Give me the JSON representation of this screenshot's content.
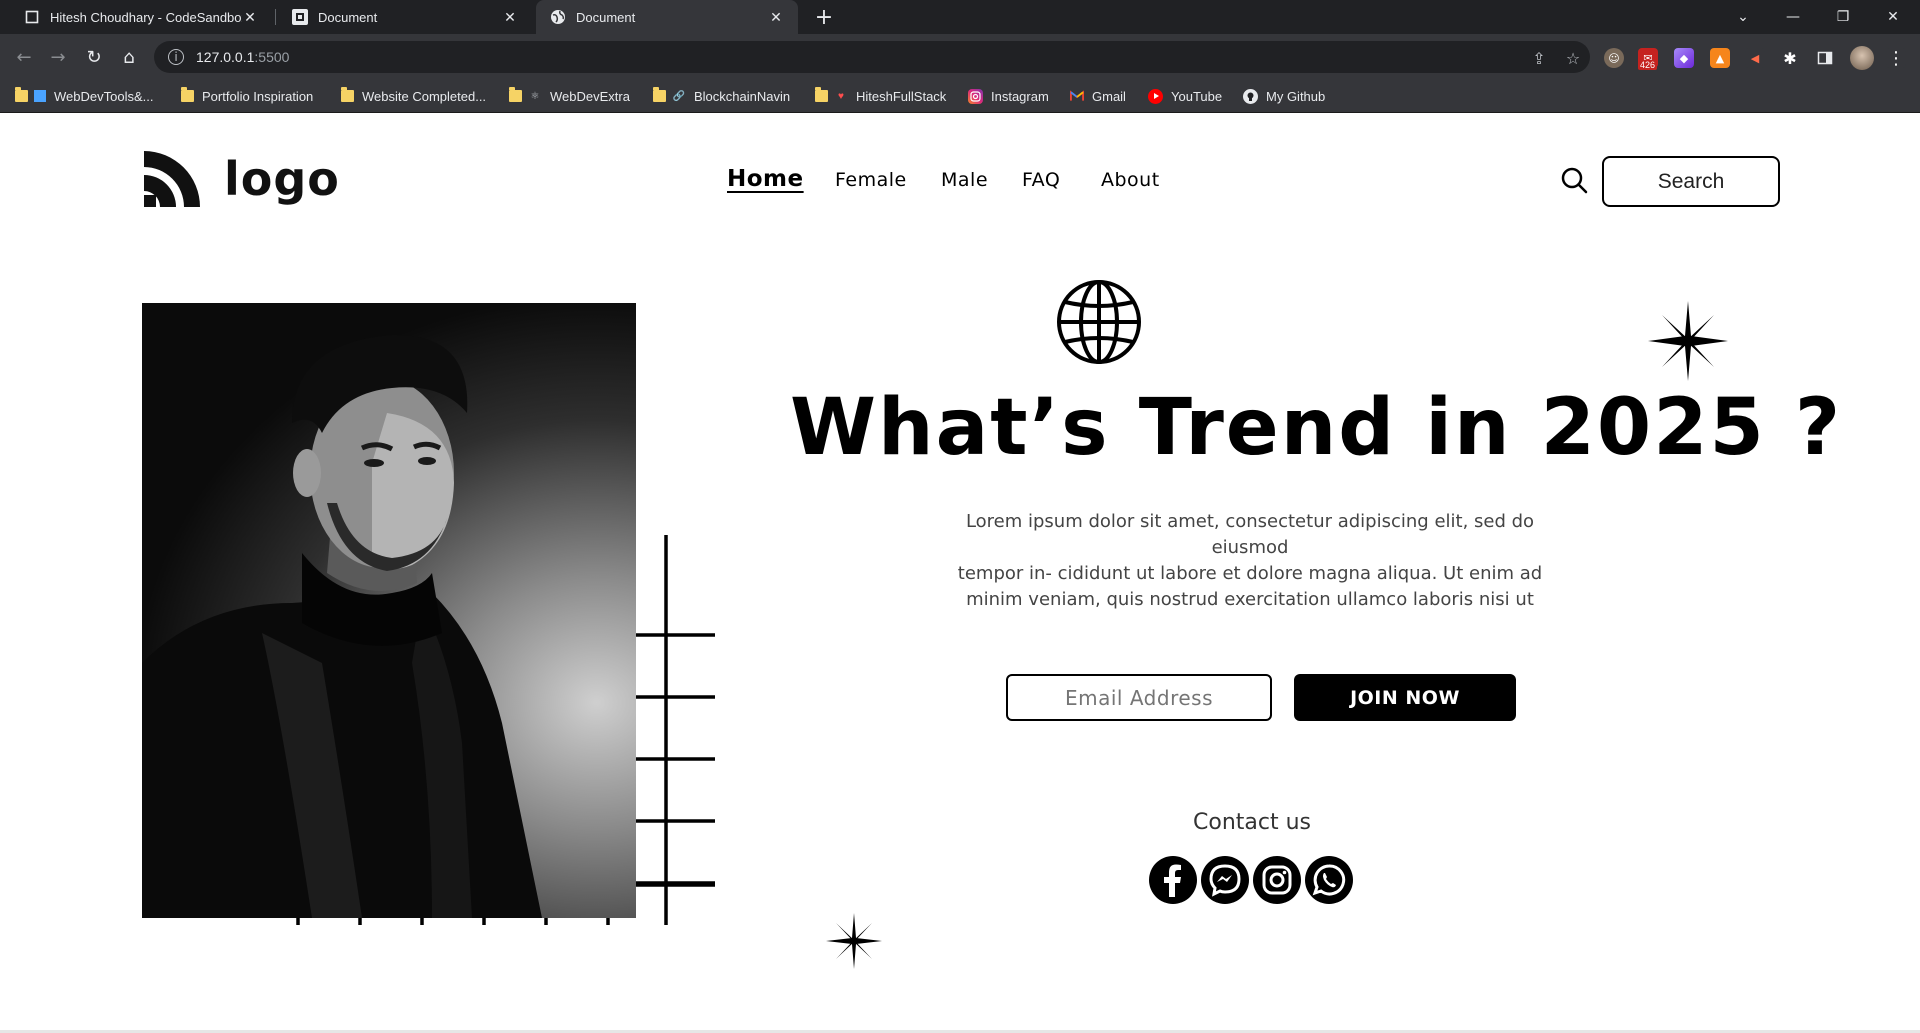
{
  "browser": {
    "tabs": [
      {
        "title": "Hitesh Choudhary - CodeSandbox",
        "favicon": "square-icon",
        "active": false
      },
      {
        "title": "Document",
        "favicon": "codesandbox-icon",
        "active": false
      },
      {
        "title": "Document",
        "favicon": "globe-icon",
        "active": true
      }
    ],
    "address": {
      "host": "127.0.0.1",
      "port": ":5500"
    },
    "extension_badge": "426",
    "bookmarks": [
      {
        "label": "WebDevTools&...",
        "icon": "folder-icon"
      },
      {
        "label": "Portfolio Inspiration",
        "icon": "folder-icon"
      },
      {
        "label": "Website Completed...",
        "icon": "folder-icon"
      },
      {
        "label": "WebDevExtra",
        "icon": "folder-icon"
      },
      {
        "label": "BlockchainNavin",
        "icon": "folder-icon"
      },
      {
        "label": "HiteshFullStack",
        "icon": "folder-icon"
      },
      {
        "label": "Instagram",
        "icon": "instagram-icon"
      },
      {
        "label": "Gmail",
        "icon": "gmail-icon"
      },
      {
        "label": "YouTube",
        "icon": "youtube-icon"
      },
      {
        "label": "My Github",
        "icon": "github-icon"
      }
    ]
  },
  "site": {
    "logo_text": "logo",
    "nav": [
      {
        "label": "Home",
        "active": true
      },
      {
        "label": "Female",
        "active": false
      },
      {
        "label": "Male",
        "active": false
      },
      {
        "label": "FAQ",
        "active": false
      },
      {
        "label": "About",
        "active": false
      }
    ],
    "search_label": "Search",
    "hero": {
      "headline": "What’s Trend in 2025 ?",
      "description_lines": [
        "Lorem ipsum dolor sit amet, consectetur adipiscing elit, sed do eiusmod",
        "tempor in- cididunt ut labore et dolore magna aliqua. Ut enim ad",
        "minim veniam, quis nostrud exercitation ullamco laboris nisi ut"
      ],
      "email_placeholder": "Email Address",
      "join_label": "JOIN NOW"
    },
    "contact": {
      "heading": "Contact us",
      "socials": [
        "facebook-icon",
        "messenger-icon",
        "instagram-icon",
        "whatsapp-icon"
      ]
    }
  }
}
